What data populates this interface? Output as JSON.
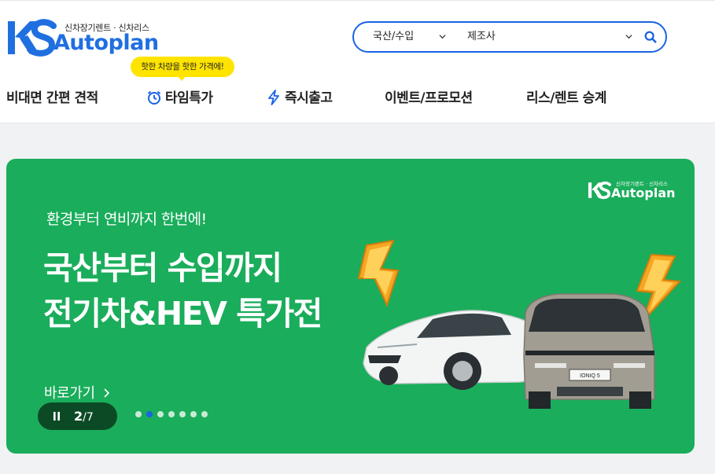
{
  "header": {
    "logo_tagline": "신차장기렌트 · 신차리스",
    "logo_word": "Autoplan",
    "search": {
      "category_value": "국산/수입",
      "maker_value": "제조사"
    },
    "promo_bubble": "핫한 차량을 핫한 가격에!",
    "nav": [
      {
        "label": "비대면 간편 견적"
      },
      {
        "label": "타임특가",
        "icon": "alarm-clock-icon"
      },
      {
        "label": "즉시출고",
        "icon": "lightning-icon"
      },
      {
        "label": "이벤트/프로모션"
      },
      {
        "label": "리스/렌트 승계"
      }
    ]
  },
  "banner": {
    "logo_tagline": "신차장기렌트 · 신차리스",
    "logo_word": "Autoplan",
    "subtitle": "환경부터 연비까지 한번에!",
    "title_line1": "국산부터 수입까지",
    "title_line2": "전기차&HEV 특가전",
    "link_label": "바로가기",
    "current_slide": "2",
    "total_slides": "/7",
    "dot_count": 7,
    "active_dot": 1,
    "car_badge": "IONIQ 5"
  },
  "colors": {
    "brand_blue": "#1a63e5",
    "banner_green": "#1aad5b",
    "bubble_yellow": "#ffe400",
    "control_dark_green": "#0c4a26"
  }
}
